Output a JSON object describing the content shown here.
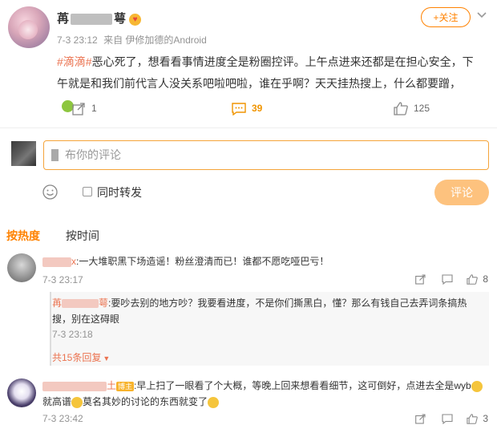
{
  "post": {
    "username_visible": "苒",
    "username_tail": "萼",
    "timestamp": "7-3 23:12",
    "source": "来自 伊修加德的Android",
    "follow_label": "+关注",
    "hashtag": "#滴滴#",
    "body": "恶心死了，想看看事情进度全是粉圈控评。上午点进来还都是在担心安全，下午就是和我们前代言人没关系吧啦吧啦，谁在乎啊？天天挂热搜上，什么都要蹭，",
    "repost_count": "1",
    "comment_count": "39",
    "like_count": "125"
  },
  "composer": {
    "placeholder": "布你的评论",
    "repost_label": "同时转发",
    "submit_label": "评论"
  },
  "sort": {
    "hot": "按热度",
    "time": "按时间"
  },
  "comments": [
    {
      "name_tail": "x",
      "text": ":一大堆职黑下场造谣！粉丝澄清而已！谁都不愿吃哑巴亏！",
      "time": "7-3 23:17",
      "likes": "8",
      "reply": {
        "name_head": "苒",
        "name_tail": "萼",
        "text": ":要吵去别的地方吵？我要看进度，不是你们撕黑白，懂？那么有钱自己去弄词条搞热搜，别在这碍眼",
        "time": "7-3 23:18"
      },
      "more_replies": "共15条回复"
    },
    {
      "name_tail": "土",
      "badge": "博主",
      "text_1": ":早上扫了一眼看了个大概，等晚上回来想看看细节，这可倒好，点进去全是wyb",
      "text_2": "就高谱",
      "text_3": "莫名其妙的讨论的东西就变了",
      "time": "7-3 23:42",
      "likes": "3"
    }
  ]
}
